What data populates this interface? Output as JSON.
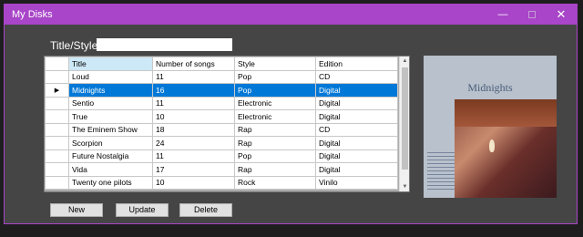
{
  "window": {
    "title": "My Disks",
    "minimize_glyph": "—",
    "close_glyph": "✕"
  },
  "search": {
    "label": "Title/Style:",
    "value": ""
  },
  "table": {
    "columns": [
      "Title",
      "Number of songs",
      "Style",
      "Edition"
    ],
    "rows": [
      [
        "Loud",
        "11",
        "Pop",
        "CD"
      ],
      [
        "Midnights",
        "16",
        "Pop",
        "Digital"
      ],
      [
        "Sentio",
        "11",
        "Electronic",
        "Digital"
      ],
      [
        "True",
        "10",
        "Electronic",
        "Digital"
      ],
      [
        "The Eminem Show",
        "18",
        "Rap",
        "CD"
      ],
      [
        "Scorpion",
        "24",
        "Rap",
        "Digital"
      ],
      [
        "Future Nostalgia",
        "11",
        "Pop",
        "Digital"
      ],
      [
        "Vida",
        "17",
        "Rap",
        "Digital"
      ],
      [
        "Twenty one pilots",
        "10",
        "Rock",
        "Vinilo"
      ]
    ],
    "selected_row": 1,
    "row_pointer": "▶"
  },
  "buttons": {
    "new": "New",
    "update": "Update",
    "delete": "Delete"
  },
  "cover": {
    "album_title": "Midnights"
  },
  "colors": {
    "accent": "#a845c8",
    "selection": "#0078d7",
    "window_bg": "#454545"
  }
}
